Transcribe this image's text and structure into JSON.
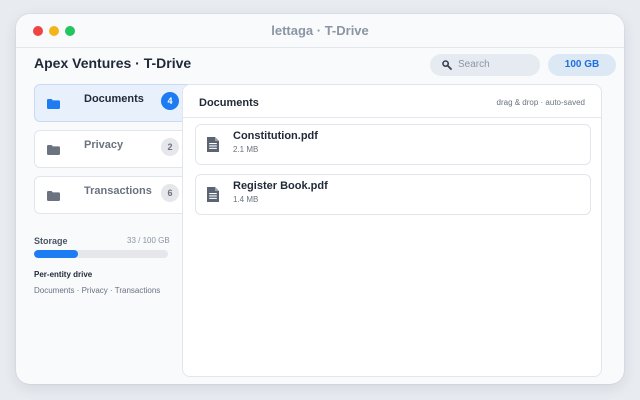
{
  "window": {
    "title": "lettaga · T-Drive"
  },
  "page": {
    "title": "Apex Ventures · T-Drive"
  },
  "search": {
    "placeholder": "Search",
    "icon": "search-icon"
  },
  "quota": {
    "label": "100 GB"
  },
  "sidebar": {
    "items": [
      {
        "label": "Documents",
        "count": "4",
        "active": true,
        "icon": "folder-icon"
      },
      {
        "label": "Privacy",
        "count": "2",
        "active": false,
        "icon": "folder-icon"
      },
      {
        "label": "Transactions",
        "count": "6",
        "active": false,
        "icon": "folder-icon"
      }
    ]
  },
  "storage": {
    "label": "Storage",
    "value": "33 / 100 GB",
    "used_fraction": 0.33
  },
  "info": {
    "title": "Per-entity drive",
    "description": "Documents · Privacy · Transactions"
  },
  "main": {
    "title": "Documents",
    "hint": "drag & drop · auto-saved",
    "files": [
      {
        "name": "Constitution.pdf",
        "size": "2.1 MB",
        "icon": "document-icon"
      },
      {
        "name": "Register Book.pdf",
        "size": "1.4 MB",
        "icon": "document-icon"
      }
    ]
  },
  "colors": {
    "accent": "#1d7cf2",
    "window_bg": "#f8fafc",
    "page_bg": "#e8ecf1",
    "dot_red": "#ef4444",
    "dot_yellow": "#f5b31b",
    "dot_green": "#22c55e"
  }
}
